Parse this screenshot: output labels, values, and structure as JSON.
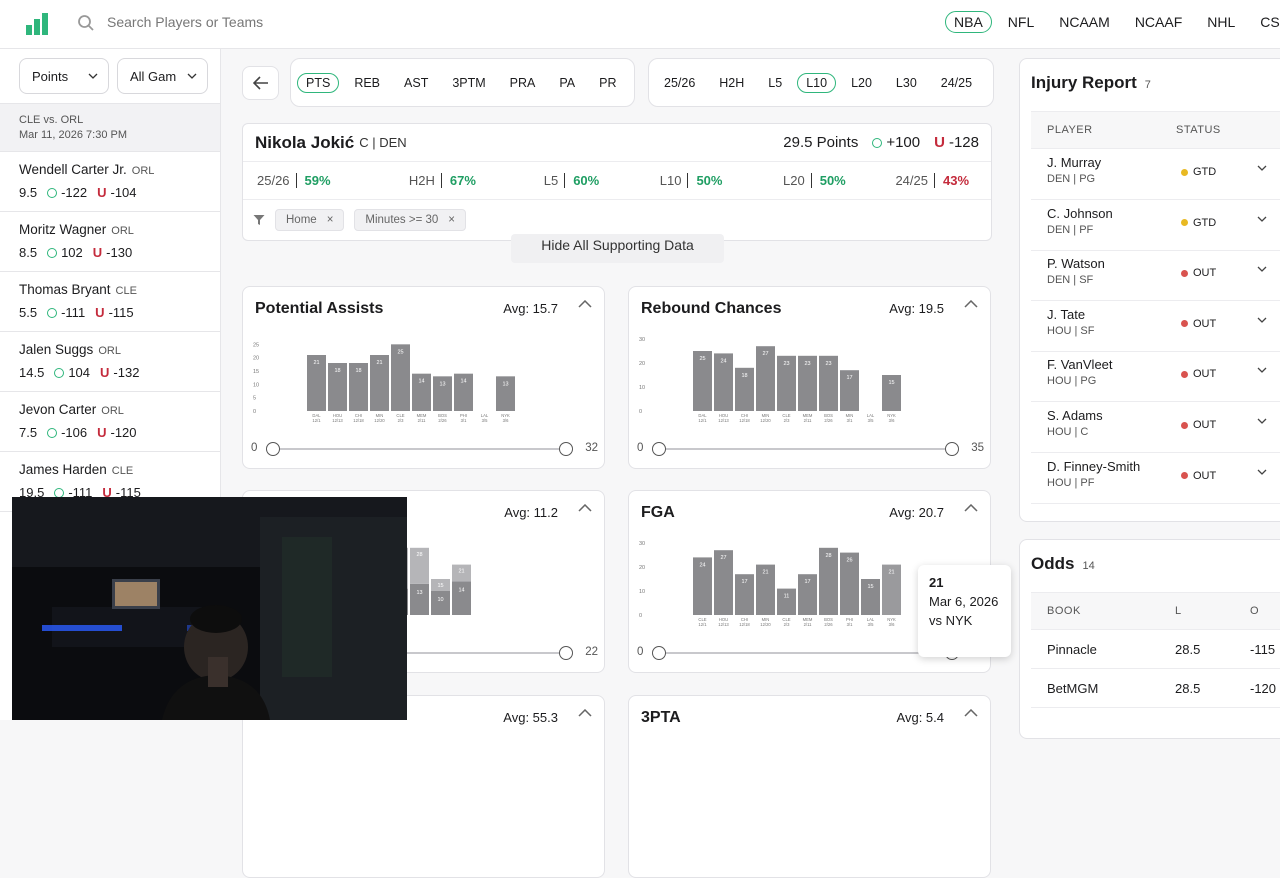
{
  "header": {
    "search_placeholder": "Search Players or Teams",
    "leagues": [
      {
        "label": "NBA",
        "active": true
      },
      {
        "label": "NFL",
        "active": false
      },
      {
        "label": "NCAAM",
        "active": false
      },
      {
        "label": "NCAAF",
        "active": false
      },
      {
        "label": "NHL",
        "active": false
      },
      {
        "label": "CSGO",
        "active": false
      }
    ]
  },
  "sidebar": {
    "stat_select": "Points",
    "games_select": "All Gam",
    "game": {
      "matchup": "CLE vs. ORL",
      "datetime": "Mar 11, 2026 7:30 PM"
    },
    "players": [
      {
        "name": "Wendell Carter Jr.",
        "team": "ORL",
        "line": "9.5",
        "over": "-122",
        "under": "-104"
      },
      {
        "name": "Moritz Wagner",
        "team": "ORL",
        "line": "8.5",
        "over": "102",
        "under": "-130"
      },
      {
        "name": "Thomas Bryant",
        "team": "CLE",
        "line": "5.5",
        "over": "-111",
        "under": "-115"
      },
      {
        "name": "Jalen Suggs",
        "team": "ORL",
        "line": "14.5",
        "over": "104",
        "under": "-132"
      },
      {
        "name": "Jevon Carter",
        "team": "ORL",
        "line": "7.5",
        "over": "-106",
        "under": "-120"
      },
      {
        "name": "James Harden",
        "team": "CLE",
        "line": "19.5",
        "over": "-111",
        "under": "-115"
      }
    ]
  },
  "main": {
    "stat_tabs": [
      {
        "label": "PTS",
        "active": true
      },
      {
        "label": "REB",
        "active": false
      },
      {
        "label": "AST",
        "active": false
      },
      {
        "label": "3PTM",
        "active": false
      },
      {
        "label": "PRA",
        "active": false
      },
      {
        "label": "PA",
        "active": false
      },
      {
        "label": "PR",
        "active": false
      }
    ],
    "range_tabs": [
      {
        "label": "25/26",
        "active": false
      },
      {
        "label": "H2H",
        "active": false
      },
      {
        "label": "L5",
        "active": false
      },
      {
        "label": "L10",
        "active": true
      },
      {
        "label": "L20",
        "active": false
      },
      {
        "label": "L30",
        "active": false
      },
      {
        "label": "24/25",
        "active": false
      }
    ],
    "player": {
      "name": "Nikola Jokić",
      "pos_team": "C | DEN",
      "line": "29.5 Points",
      "over": "+100",
      "under": "-128"
    },
    "hit_rates": [
      {
        "label": "25/26",
        "value": "59%",
        "color": "green"
      },
      {
        "label": "H2H",
        "value": "67%",
        "color": "green"
      },
      {
        "label": "L5",
        "value": "60%",
        "color": "green"
      },
      {
        "label": "L10",
        "value": "50%",
        "color": "green"
      },
      {
        "label": "L20",
        "value": "50%",
        "color": "green"
      },
      {
        "label": "24/25",
        "value": "43%",
        "color": "red"
      }
    ],
    "filters": [
      "Home",
      "Minutes >= 30"
    ],
    "hide_label": "Hide All Supporting Data",
    "tooltip": {
      "value": "21",
      "date": "Mar 6, 2026",
      "opponent": "vs NYK"
    }
  },
  "chart_data": [
    {
      "type": "bar",
      "title": "Potential Assists",
      "avg": "Avg: 15.7",
      "categories": [
        "DAL 12/1",
        "HOU 12/13",
        "CHI 12/18",
        "MIN 12/20",
        "CLE 2/3",
        "MEM 2/11",
        "BOS 2/26",
        "PHI 3/1",
        "LAL 3/5",
        "NYK 3/6"
      ],
      "values": [
        21,
        18,
        18,
        21,
        25,
        14,
        13,
        14,
        0,
        13
      ],
      "yticks": [
        0,
        5,
        10,
        15,
        20,
        25
      ],
      "ylim": [
        0,
        27
      ],
      "slider": {
        "min": "0",
        "max": "32",
        "low": 0,
        "high": 32,
        "range": [
          0,
          32
        ]
      }
    },
    {
      "type": "bar",
      "title": "Rebound Chances",
      "avg": "Avg: 19.5",
      "categories": [
        "DAL 12/1",
        "HOU 12/13",
        "CHI 12/18",
        "MIN 12/20",
        "CLE 2/3",
        "MEM 2/11",
        "BOS 2/26",
        "MIN 3/1",
        "LAL 3/5",
        "NYK 3/6"
      ],
      "values": [
        25,
        24,
        18,
        27,
        23,
        23,
        23,
        17,
        0,
        15
      ],
      "yticks": [
        0,
        10,
        20,
        30
      ],
      "ylim": [
        0,
        30
      ],
      "slider": {
        "min": "0",
        "max": "35",
        "low": 0,
        "high": 35,
        "range": [
          0,
          35
        ]
      }
    },
    {
      "type": "bar",
      "stacked": true,
      "title": "",
      "avg": "Avg: 11.2",
      "categories": [
        "",
        "",
        "",
        "",
        "MEM",
        "BOS",
        "PHI",
        "MIN",
        "NYK"
      ],
      "series": [
        {
          "values": [
            0,
            0,
            0,
            6,
            8,
            11,
            13,
            10,
            14
          ]
        },
        {
          "values": [
            0,
            0,
            0,
            0,
            9,
            17,
            15,
            5,
            7
          ]
        }
      ],
      "labels_top": [
        "",
        "",
        "",
        "",
        "17",
        "28",
        "28",
        "15",
        "21"
      ],
      "ylim": [
        0,
        30
      ],
      "slider": {
        "min": "",
        "max": "22",
        "low": 0,
        "high": 22,
        "range": [
          0,
          22
        ]
      }
    },
    {
      "type": "bar",
      "title": "FGA",
      "avg": "Avg: 20.7",
      "categories": [
        "CLE 12/1",
        "HOU 12/13",
        "CHI 12/18",
        "MIN 12/20",
        "CLE 2/3",
        "MEM 2/11",
        "BOS 2/26",
        "PHI 3/1",
        "LAL 3/5",
        "NYK 3/6"
      ],
      "values": [
        24,
        27,
        17,
        21,
        11,
        17,
        28,
        26,
        15,
        21
      ],
      "yticks": [
        0,
        10,
        20,
        30
      ],
      "ylim": [
        0,
        30
      ],
      "slider": {
        "min": "0",
        "max": "39",
        "low": 0,
        "high": 39,
        "range": [
          0,
          39
        ]
      }
    }
  ],
  "bottom_cards": [
    {
      "title": "",
      "avg": "Avg: 55.3"
    },
    {
      "title": "3PTA",
      "avg": "Avg: 5.4"
    }
  ],
  "injury_report": {
    "title": "Injury Report",
    "count": "7",
    "headers": [
      "PLAYER",
      "STATUS"
    ],
    "rows": [
      {
        "name": "J. Murray",
        "team": "DEN | PG",
        "status": "GTD",
        "color": "#e8b923"
      },
      {
        "name": "C. Johnson",
        "team": "DEN | PF",
        "status": "GTD",
        "color": "#e8b923"
      },
      {
        "name": "P. Watson",
        "team": "DEN | SF",
        "status": "OUT",
        "color": "#d9534f"
      },
      {
        "name": "J. Tate",
        "team": "HOU | SF",
        "status": "OUT",
        "color": "#d9534f"
      },
      {
        "name": "F. VanVleet",
        "team": "HOU | PG",
        "status": "OUT",
        "color": "#d9534f"
      },
      {
        "name": "S. Adams",
        "team": "HOU | C",
        "status": "OUT",
        "color": "#d9534f"
      },
      {
        "name": "D. Finney-Smith",
        "team": "HOU | PF",
        "status": "OUT",
        "color": "#d9534f"
      }
    ]
  },
  "odds": {
    "title": "Odds",
    "count": "14",
    "headers": [
      "BOOK",
      "L",
      "O"
    ],
    "rows": [
      {
        "book": "Pinnacle",
        "line": "28.5",
        "over": "-115"
      },
      {
        "book": "BetMGM",
        "line": "28.5",
        "over": "-120"
      }
    ]
  },
  "colors": {
    "accent": "#2fb67c",
    "bar": "#8a8a8d",
    "bar_light": "#b0b0b3",
    "under": "#c42b3c"
  }
}
